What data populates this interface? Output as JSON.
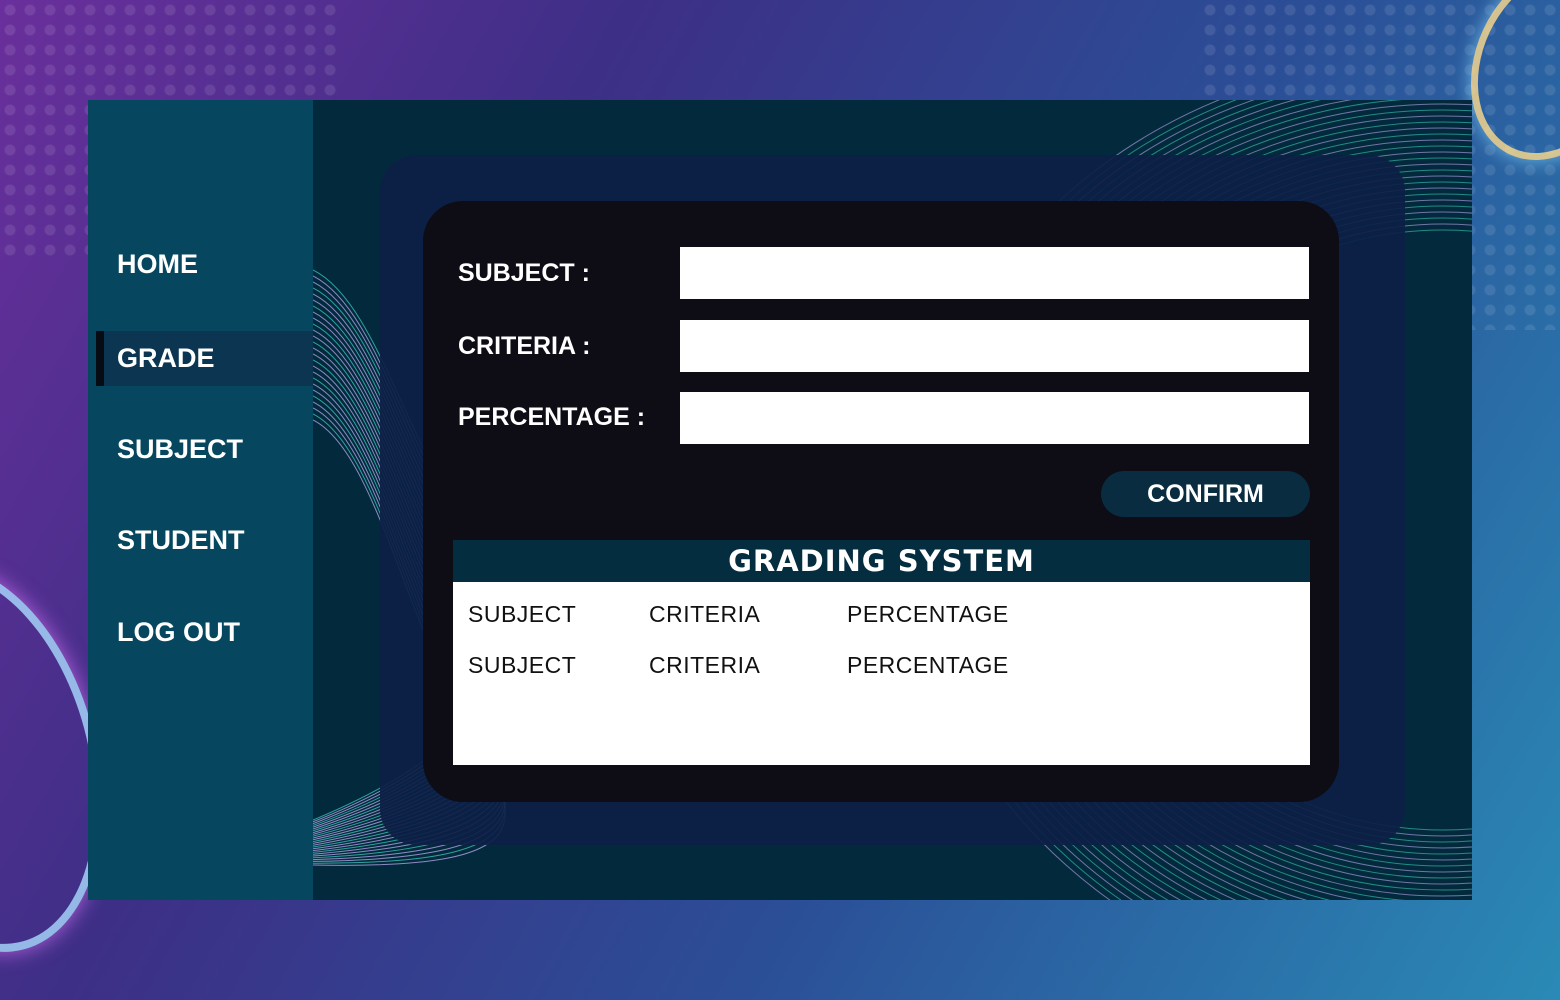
{
  "nav": {
    "items": [
      {
        "label": "HOME",
        "active": false
      },
      {
        "label": "GRADE",
        "active": true
      },
      {
        "label": "SUBJECT",
        "active": false
      },
      {
        "label": "STUDENT",
        "active": false
      },
      {
        "label": "LOG OUT",
        "active": false
      }
    ]
  },
  "form": {
    "subject_label": "SUBJECT :",
    "subject_value": "",
    "criteria_label": "CRITERIA :",
    "criteria_value": "",
    "percentage_label": "PERCENTAGE :",
    "percentage_value": "",
    "confirm_label": "CONFIRM"
  },
  "grading_table": {
    "title": "GRADING SYSTEM",
    "rows": [
      {
        "subject": "SUBJECT",
        "criteria": "CRITERIA",
        "percentage": "PERCENTAGE"
      },
      {
        "subject": "SUBJECT",
        "criteria": "CRITERIA",
        "percentage": "PERCENTAGE"
      }
    ]
  },
  "colors": {
    "sidebar": "#06465f",
    "active_item": "#0b3550",
    "content": "#032a3c",
    "card": "#0e0c15",
    "table_header": "#052d40",
    "wave_teal": "#3fd9c8",
    "wave_lilac": "#c9b4ff"
  }
}
